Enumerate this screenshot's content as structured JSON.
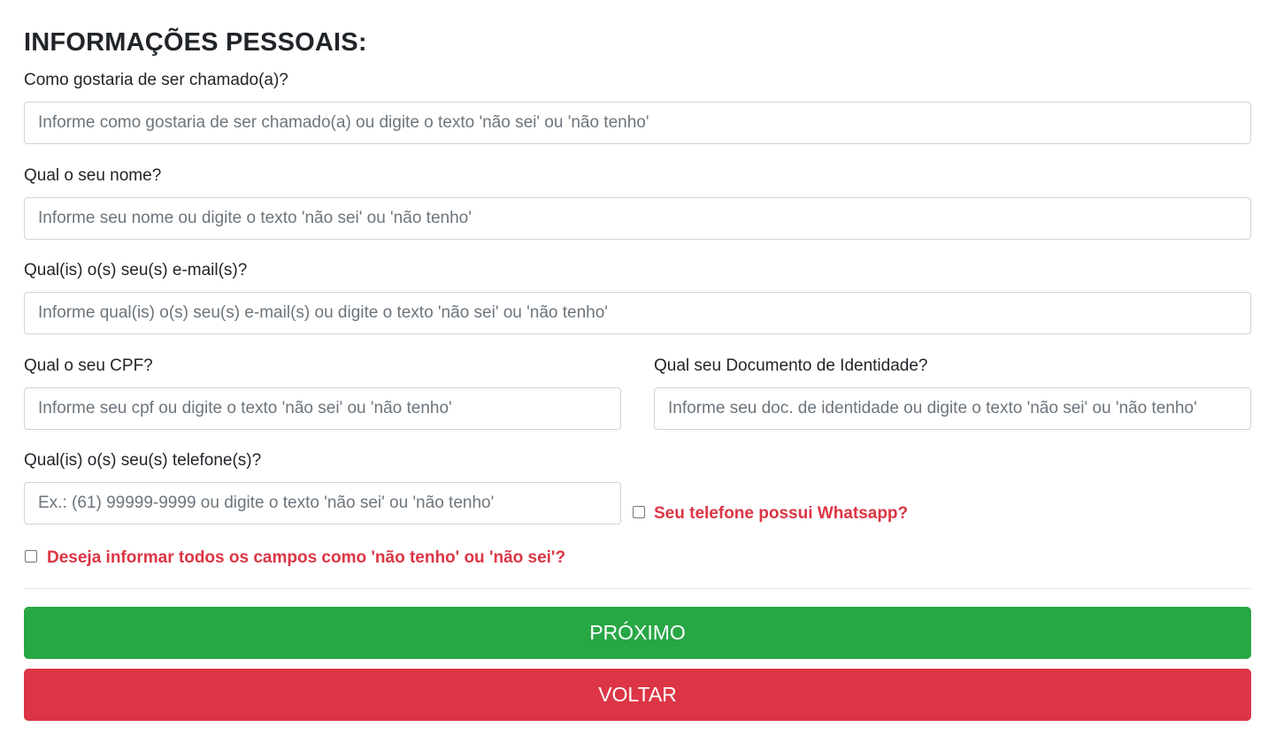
{
  "page": {
    "title": "INFORMAÇÕES PESSOAIS:"
  },
  "fields": {
    "nickname": {
      "label": "Como gostaria de ser chamado(a)?",
      "placeholder": "Informe como gostaria de ser chamado(a) ou digite o texto 'não sei' ou 'não tenho'",
      "value": ""
    },
    "name": {
      "label": "Qual o seu nome?",
      "placeholder": "Informe seu nome ou digite o texto 'não sei' ou 'não tenho'",
      "value": ""
    },
    "email": {
      "label": "Qual(is) o(s) seu(s) e-mail(s)?",
      "placeholder": "Informe qual(is) o(s) seu(s) e-mail(s) ou digite o texto 'não sei' ou 'não tenho'",
      "value": ""
    },
    "cpf": {
      "label": "Qual o seu CPF?",
      "placeholder": "Informe seu cpf ou digite o texto 'não sei' ou 'não tenho'",
      "value": ""
    },
    "identity": {
      "label": "Qual seu Documento de Identidade?",
      "placeholder": "Informe seu doc. de identidade ou digite o texto 'não sei' ou 'não tenho'",
      "value": ""
    },
    "phone": {
      "label": "Qual(is) o(s) seu(s) telefone(s)?",
      "placeholder": "Ex.: (61) 99999-9999 ou digite o texto 'não sei' ou 'não tenho'",
      "value": ""
    }
  },
  "checkboxes": {
    "whatsapp": {
      "label": "Seu telefone possui Whatsapp?",
      "checked": false
    },
    "all_unknown": {
      "label": "Deseja informar todos os campos como 'não tenho' ou 'não sei'?",
      "checked": false
    }
  },
  "buttons": {
    "next_label": "PRÓXIMO",
    "back_label": "VOLTAR"
  },
  "colors": {
    "next_button": "#28a745",
    "back_button": "#dc3545",
    "checkbox_label": "#dc3545",
    "input_border": "#ced4da"
  }
}
